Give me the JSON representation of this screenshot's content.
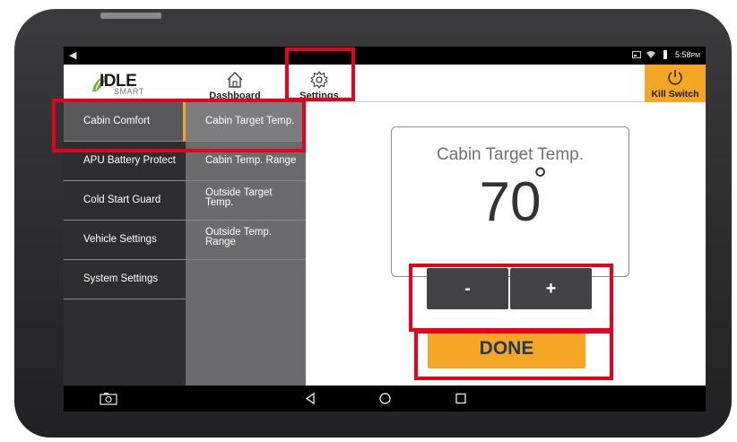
{
  "statusbar": {
    "time": "5:58",
    "ampm": "PM"
  },
  "brand": {
    "name": "IDLE",
    "sub": "SMART",
    "icon": "leaf-logo-icon"
  },
  "topnav": {
    "items": [
      {
        "label": "Dashboard",
        "icon": "home-icon"
      },
      {
        "label": "Settings",
        "icon": "gear-icon"
      }
    ],
    "kill_switch": {
      "label": "Kill Switch",
      "icon": "power-icon"
    }
  },
  "menu_primary": [
    {
      "label": "Cabin Comfort",
      "active": true
    },
    {
      "label": "APU Battery Protect"
    },
    {
      "label": "Cold Start Guard"
    },
    {
      "label": "Vehicle Settings"
    },
    {
      "label": "System Settings"
    }
  ],
  "menu_secondary": [
    {
      "label": "Cabin Target Temp.",
      "active": true
    },
    {
      "label": "Cabin Temp. Range"
    },
    {
      "label_l1": "Outside Target",
      "label_l2": "Temp."
    },
    {
      "label_l1": "Outside Temp.",
      "label_l2": "Range"
    }
  ],
  "temp_card": {
    "title": "Cabin Target Temp.",
    "value": "70",
    "degree": "°"
  },
  "controls": {
    "decrease": "-",
    "increase": "+",
    "done": "DONE"
  },
  "colors": {
    "accent": "#f5a623",
    "highlight": "#e8001c",
    "panel_dark": "#2e2e30",
    "panel_mid": "#6b6b6d"
  }
}
